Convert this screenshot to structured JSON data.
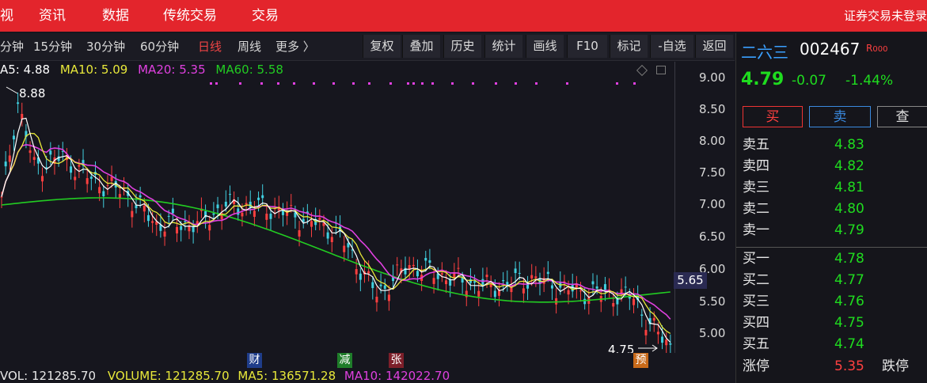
{
  "top_nav": {
    "items": [
      "视",
      "资讯",
      "数据",
      "传统交易",
      "交易"
    ],
    "login_status": "证券交易未登录"
  },
  "toolbar": {
    "periods": [
      "分钟",
      "15分钟",
      "30分钟",
      "60分钟",
      "日线",
      "周线",
      "更多 〉"
    ],
    "active_period": "日线",
    "buttons": [
      "复权",
      "叠加",
      "历史",
      "统计",
      "画线",
      "F10",
      "标记",
      "-自选",
      "返回"
    ]
  },
  "ma": {
    "ma5_label": "A5: 4.88",
    "ma10_label": "MA10: 5.09",
    "ma20_label": "MA20: 5.35",
    "ma60_label": "MA60: 5.58",
    "colors": {
      "ma5": "#ffffff",
      "ma10": "#e8e83a",
      "ma20": "#e040e0",
      "ma60": "#22cc22"
    }
  },
  "price_axis": {
    "ticks": [
      "9.00",
      "8.50",
      "8.00",
      "7.50",
      "7.00",
      "6.50",
      "6.00",
      "5.50",
      "5.00"
    ],
    "cursor_value": "5.65"
  },
  "chart_annotations": {
    "high_label": "8.88",
    "low_label": "4.75",
    "markers": [
      "财",
      "减",
      "张",
      "预"
    ]
  },
  "volume": {
    "vol_label": "VOL: 121285.70",
    "volume_label": "VOLUME: 121285.70",
    "ma5_label": "MA5: 136571.28",
    "ma10_label": "MA10: 142022.70"
  },
  "stock": {
    "name": "二六三",
    "code": "002467",
    "badge": "R",
    "badge_suffix": "000",
    "price": "4.79",
    "change": "-0.07",
    "change_pct": "-1.44%"
  },
  "actions": {
    "buy": "买",
    "sell": "卖",
    "query": "查"
  },
  "order_book": {
    "sells": [
      {
        "label": "卖五",
        "price": "4.83"
      },
      {
        "label": "卖四",
        "price": "4.82"
      },
      {
        "label": "卖三",
        "price": "4.81"
      },
      {
        "label": "卖二",
        "price": "4.80"
      },
      {
        "label": "卖一",
        "price": "4.79"
      }
    ],
    "buys": [
      {
        "label": "买一",
        "price": "4.78"
      },
      {
        "label": "买二",
        "price": "4.77"
      },
      {
        "label": "买三",
        "price": "4.76"
      },
      {
        "label": "买四",
        "price": "4.75"
      },
      {
        "label": "买五",
        "price": "4.74"
      }
    ]
  },
  "limits": {
    "up_label": "涨停",
    "up_value": "5.35",
    "down_label": "跌停"
  },
  "colors": {
    "brand_red": "#e3252c",
    "up": "#ff4040",
    "down": "#1fdc1f",
    "cyan_candle": "#40d0e0"
  }
}
